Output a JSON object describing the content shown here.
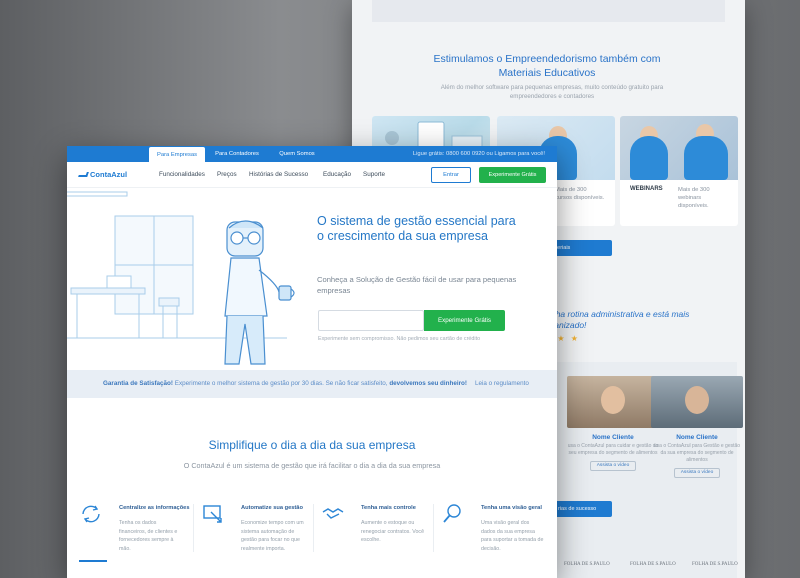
{
  "back_page": {
    "heading": "Estimulamos o Empreendedorismo também com Materiais Educativos",
    "subheading": "Além do melhor software para pequenas empresas, muito conteúdo gratuito para empreendedores e contadores",
    "cards": [
      {
        "label": "",
        "desc": ""
      },
      {
        "label": "",
        "desc": "Mais de 300 cursos disponíveis."
      },
      {
        "label": "WEBINARS",
        "desc": "Mais de 300 webinars disponíveis."
      }
    ],
    "materials_button": "materiais",
    "quote": "minha rotina administrativa e está mais organizado!",
    "stars": "★ ★ ★",
    "testimonials": [
      {
        "name": "Nome Cliente",
        "desc": "usa o ContaAzul para cuidar e gestão do seu empresa do segmento de alimentos",
        "watch": "Assista o vídeo"
      },
      {
        "name": "Nome Cliente",
        "desc": "usa o ContaAzul para Gestão e gestão da sua empresa do segmento de alimentos",
        "watch": "Assista o vídeo"
      }
    ],
    "success_button": "rias de sucesso",
    "logos": [
      "FOLHA DE S.PAULO",
      "FOLHA DE S.PAULO",
      "FOLHA DE S.PAULO"
    ]
  },
  "front_page": {
    "topbar": {
      "tabs": [
        "Para Empresas",
        "Para Contadores",
        "Quem Somos"
      ],
      "phone": "Ligue grátis: 0800 600 0920 ou Ligamos para você!"
    },
    "nav": {
      "logo": "ContaAzul",
      "links": [
        "Funcionalidades",
        "Preços",
        "Histórias de Sucesso",
        "Educação",
        "Suporte"
      ],
      "enter": "Entrar",
      "try": "Experimente Grátis"
    },
    "hero": {
      "title": "O sistema de gestão essencial para o crescimento da sua empresa",
      "subtitle": "Conheça a Solução de Gestão fácil de usar para pequenas empresas",
      "email_placeholder": "",
      "cta": "Experimente Grátis",
      "note": "Experimente sem compromisso. Não pedimos seu cartão de crédito"
    },
    "guarantee": {
      "label": "Garantia de Satisfação!",
      "text": " Experimente o melhor sistema de gestão por 30 dias. Se não ficar satisfeito, ",
      "bold": "devolvemos seu dinheiro!",
      "link": "Leia o regulamento"
    },
    "simplify": {
      "title": "Simplifique o dia a dia da sua empresa",
      "subtitle": "O ContaAzul é um sistema de gestão que irá facilitar o dia a dia da sua empresa"
    },
    "features": [
      {
        "icon": "sync-icon",
        "title": "Centralize as informações",
        "desc": "Tenha os dados financeiros, de clientes e fornecedores sempre à mão."
      },
      {
        "icon": "automation-icon",
        "title": "Automatize sua gestão",
        "desc": "Economize tempo com um sistema automação de gestão para focar no que realmente importa."
      },
      {
        "icon": "handshake-icon",
        "title": "Tenha mais controle",
        "desc": "Aumente o estoque ou renegociar contratos. Você escolhe."
      },
      {
        "icon": "magnifier-icon",
        "title": "Tenha uma visão geral",
        "desc": "Uma visão geral dos dados da sua empresa para suportar a tomada de decisão."
      }
    ]
  }
}
